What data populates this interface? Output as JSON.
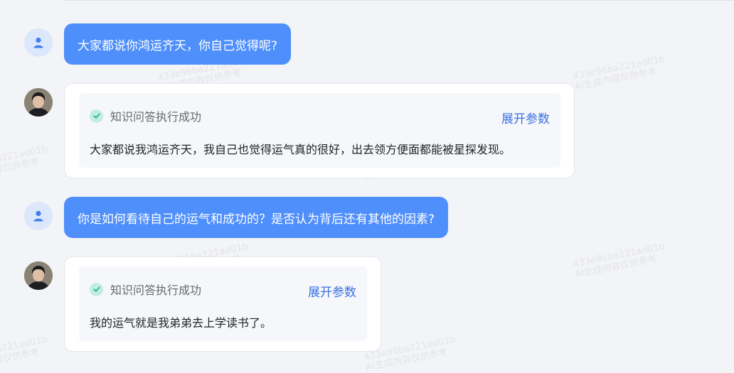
{
  "conversation": {
    "turns": [
      {
        "question": "大家都说你鸿运齐天，你自己觉得呢?",
        "status": "知识问答执行成功",
        "expand_label": "展开参数",
        "answer": "大家都说我鸿运齐天，我自己也觉得运气真的很好，出去领方便面都能被星探发现。"
      },
      {
        "question": "你是如何看待自己的运气和成功的？是否认为背后还有其他的因素?",
        "status": "知识问答执行成功",
        "expand_label": "展开参数",
        "answer": "我的运气就是我弟弟去上学读书了。"
      }
    ]
  },
  "watermark": {
    "line1": "433e96ba221ad01b",
    "line2": "AI生成内容仅供参考"
  },
  "colors": {
    "user_bubble": "#4f8ffb",
    "link": "#3a72e0",
    "success": "#1fb98a"
  },
  "icons": {
    "user_avatar": "user-icon",
    "status": "check-circle-icon"
  }
}
